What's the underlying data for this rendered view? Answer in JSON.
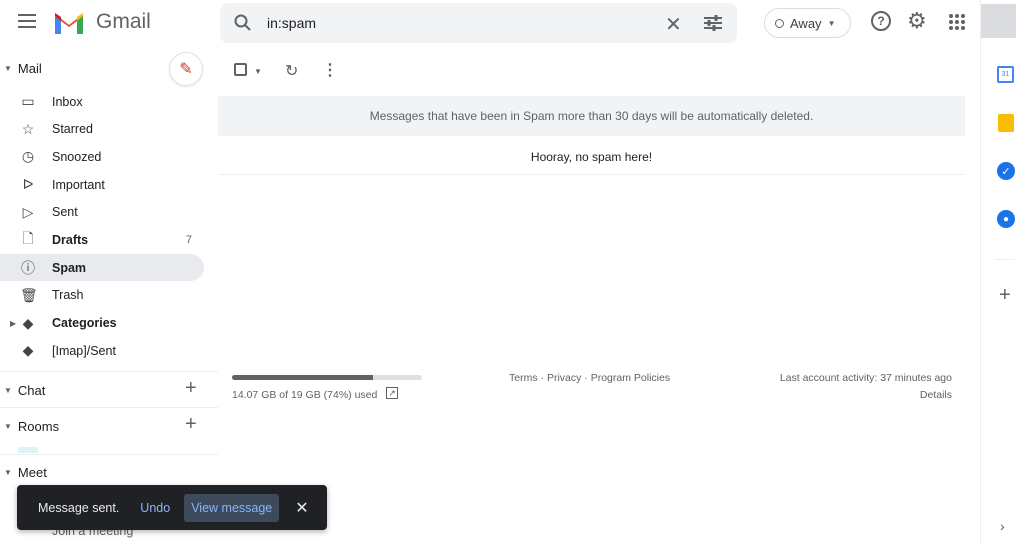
{
  "header": {
    "app_name": "Gmail",
    "search_value": "in:spam",
    "status": "Away"
  },
  "sidebar": {
    "mail_label": "Mail",
    "items": [
      {
        "label": "Inbox",
        "icon": "inbox-icon",
        "glyph": "▭"
      },
      {
        "label": "Starred",
        "icon": "star-icon",
        "glyph": "☆"
      },
      {
        "label": "Snoozed",
        "icon": "clock-icon",
        "glyph": "◷"
      },
      {
        "label": "Important",
        "icon": "important-icon",
        "glyph": "ᐅ"
      },
      {
        "label": "Sent",
        "icon": "send-icon",
        "glyph": "▷"
      },
      {
        "label": "Drafts",
        "icon": "draft-icon",
        "glyph": "🗋",
        "count": "7",
        "bold": true
      },
      {
        "label": "Spam",
        "icon": "spam-icon",
        "glyph": "ⓘ",
        "bold": true,
        "active": true
      },
      {
        "label": "Trash",
        "icon": "trash-icon",
        "glyph": "🗑"
      },
      {
        "label": "Categories",
        "icon": "label-icon",
        "glyph": "◆",
        "bold": true
      },
      {
        "label": "[Imap]/Sent",
        "icon": "label-icon",
        "glyph": "◆"
      }
    ],
    "chat_label": "Chat",
    "rooms_label": "Rooms",
    "meet_label": "Meet",
    "meet_item": "Join a meeting"
  },
  "main": {
    "notice": "Messages that have been in Spam more than 30 days will be automatically deleted.",
    "empty": "Hooray, no spam here!"
  },
  "footer": {
    "storage": "14.07 GB of 19 GB (74%) used",
    "storage_percent": 74,
    "terms": "Terms",
    "privacy": "Privacy",
    "policies": "Program Policies",
    "sep": " · ",
    "activity": "Last account activity: 37 minutes ago",
    "details": "Details"
  },
  "snackbar": {
    "message": "Message sent.",
    "undo": "Undo",
    "view": "View message"
  }
}
